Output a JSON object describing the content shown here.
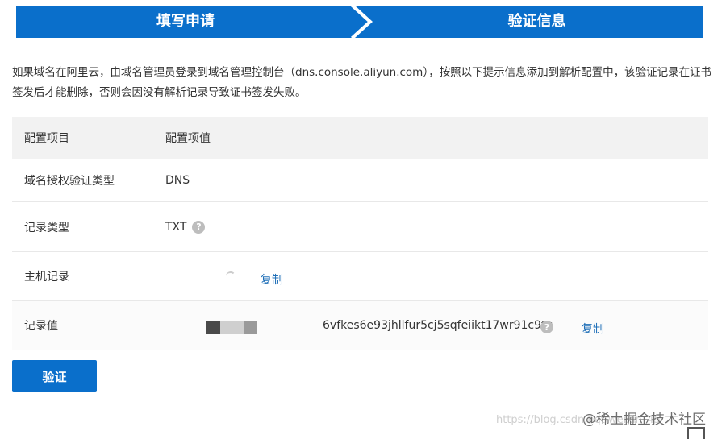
{
  "steps": [
    {
      "label": "填写申请"
    },
    {
      "label": "验证信息"
    }
  ],
  "colors": {
    "accent": "#0a6fcb",
    "link": "#1f6fb8",
    "header_bg": "#f2f2f2"
  },
  "instruction": "如果域名在阿里云，由域名管理员登录到域名管理控制台（dns.console.aliyun.com），按照以下提示信息添加到解析配置中，该验证记录在证书签发后才能删除，否则会因没有解析记录导致证书签发失败。",
  "table": {
    "headers": [
      "配置项目",
      "配置项值"
    ],
    "rows": [
      {
        "label": "域名授权验证类型",
        "value": "DNS"
      },
      {
        "label": "记录类型",
        "value": "TXT",
        "help": "?"
      },
      {
        "label": "主机记录",
        "copy": "复制"
      },
      {
        "label": "记录值",
        "value": "6vfkes6e93jhllfur5cj5sqfeiikt17wr91c9tu",
        "help": "?",
        "copy": "复制"
      }
    ]
  },
  "verify_button": "验证",
  "watermark": {
    "url": "https://blog.csdn.net/weixin_45",
    "brand": "@稀土掘金技术社区"
  }
}
